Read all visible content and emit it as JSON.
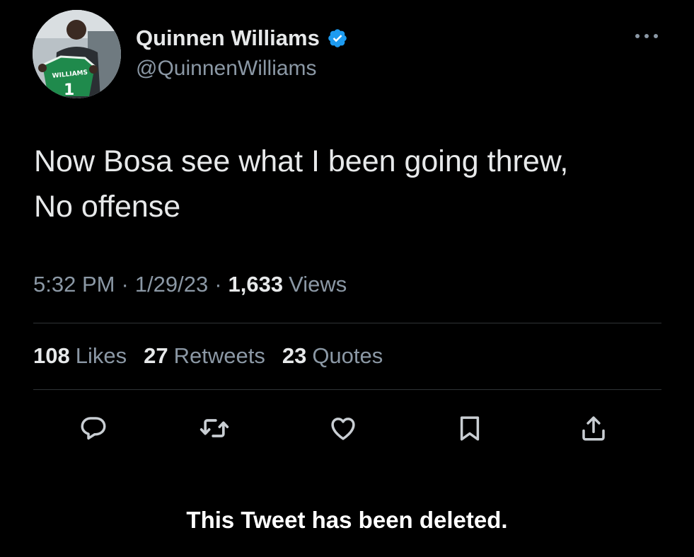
{
  "author": {
    "display_name": "Quinnen Williams",
    "handle": "@QuinnenWilliams",
    "verified_icon": "verified-badge-icon",
    "avatar_jersey_text": "WILLIAMS",
    "avatar_jersey_number": "1"
  },
  "header": {
    "more_icon": "more-options-icon"
  },
  "tweet": {
    "text_lines": [
      "Now Bosa see what I been going threw,",
      "No offense"
    ]
  },
  "meta": {
    "time": "5:32 PM",
    "separator": "·",
    "date": "1/29/23",
    "views_count": "1,633",
    "views_label": "Views"
  },
  "stats": {
    "likes_count": "108",
    "likes_label": "Likes",
    "retweets_count": "27",
    "retweets_label": "Retweets",
    "quotes_count": "23",
    "quotes_label": "Quotes"
  },
  "actions": {
    "reply_icon": "reply-icon",
    "retweet_icon": "retweet-icon",
    "like_icon": "like-heart-icon",
    "bookmark_icon": "bookmark-icon",
    "share_icon": "share-icon"
  },
  "notice": {
    "deleted_text": "This Tweet has been deleted."
  },
  "colors": {
    "background": "#000000",
    "primary_text": "#e7e9ea",
    "secondary_text": "#8b98a5",
    "divider": "#2f3336",
    "verified_blue": "#1d9bf0",
    "icon_gray": "#c9ced3"
  }
}
